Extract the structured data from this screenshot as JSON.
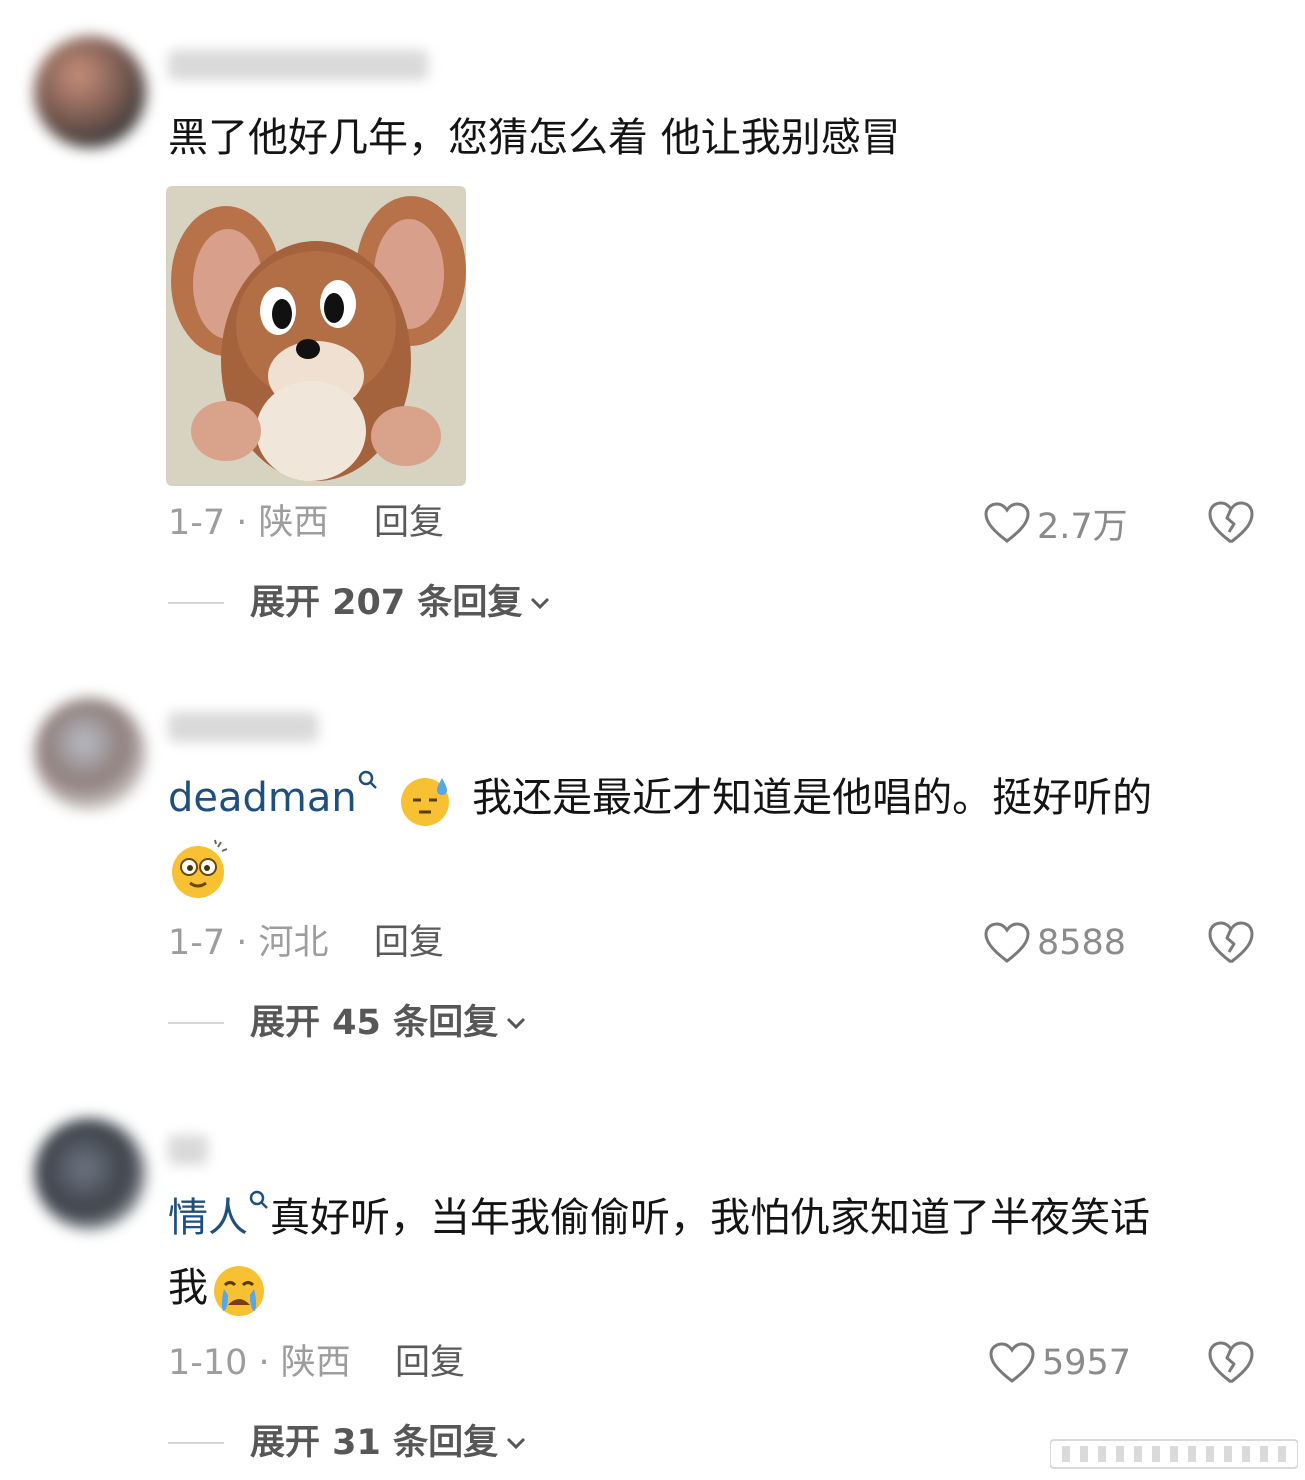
{
  "comments": [
    {
      "text": "黑了他好几年，您猜怎么着 他让我别感冒",
      "date_location": "1-7 · 陕西",
      "reply_label": "回复",
      "likes": "2.7万",
      "expand_label": "展开 207 条回复",
      "image_icon": "jerry-mouse-sticker"
    },
    {
      "mention": "deadman",
      "text": "我还是最近才知道是他唱的。挺好听的",
      "emoji_1": "sweat-smile-emoji",
      "emoji_2": "dizzy-face-emoji",
      "date_location": "1-7 · 河北",
      "reply_label": "回复",
      "likes": "8588",
      "expand_label": "展开 45 条回复"
    },
    {
      "mention": "情人",
      "text": "真好听，当年我偷偷听，我怕仇家知道了半夜笑话",
      "text_line2": "我",
      "emoji_1": "crying-face-emoji",
      "date_location": "1-10 · 陕西",
      "reply_label": "回复",
      "likes": "5957",
      "expand_label": "展开 31 条回复"
    }
  ],
  "colors": {
    "mention": "#1f4f7f",
    "meta": "#9d9d9d",
    "text": "#141414"
  }
}
